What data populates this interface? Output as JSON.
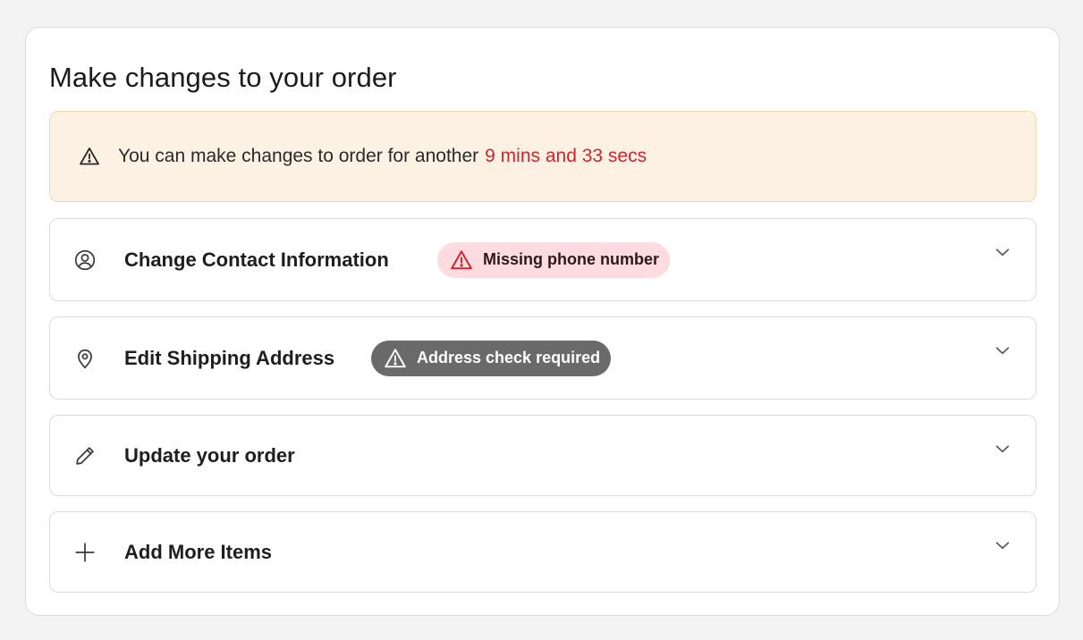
{
  "page": {
    "title": "Make changes to your order"
  },
  "alert": {
    "icon": "warning-triangle-icon",
    "text": "You can make changes to order for another",
    "time_remaining": "9 mins and 33 secs",
    "colors": {
      "background": "#fdf1e3",
      "time": "#d1242f"
    }
  },
  "sections": [
    {
      "label": "Change Contact Information",
      "icon": "user-circle-icon",
      "badge": {
        "text": "Missing phone number",
        "icon": "warning-triangle-icon",
        "style": "error",
        "background": "#fddbdf",
        "icon_color": "#d1242f"
      }
    },
    {
      "label": "Edit Shipping Address",
      "icon": "location-pin-icon",
      "badge": {
        "text": "Address check required",
        "icon": "warning-triangle-icon",
        "style": "neutral",
        "background": "#6a6a6a",
        "icon_color": "#ffffff"
      }
    },
    {
      "label": "Update your order",
      "icon": "pencil-icon"
    },
    {
      "label": "Add More Items",
      "icon": "plus-icon"
    }
  ]
}
